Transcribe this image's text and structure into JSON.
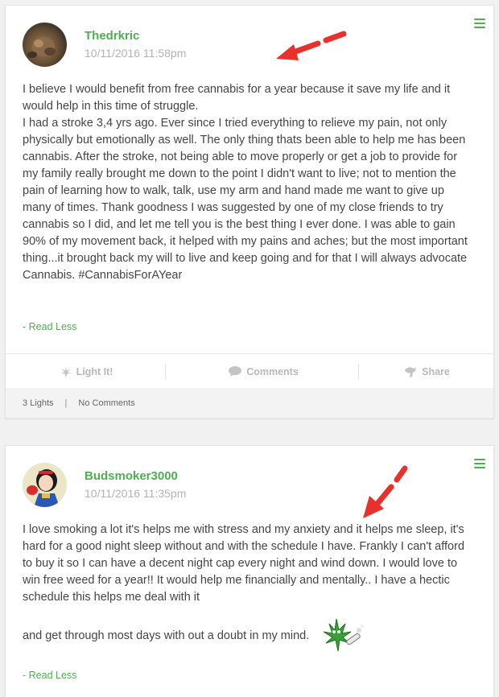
{
  "posts": [
    {
      "username": "Thedrkric",
      "timestamp": "10/11/2016 11:58pm",
      "paragraphs": [
        "I believe I would benefit from free cannabis for a year because it save my life and it would help in this time of struggle.",
        "I had a stroke 3,4 yrs ago. Ever since I tried everything to relieve my pain, not only physically but emotionally as well. The only thing thats been able to help me has been cannabis. After the stroke, not being able to move properly or get a job to provide for my family really brought me down to the point I didn't want to live; not to mention the pain of learning how to walk, talk, use my arm and hand made me want to give up many of times. Thank goodness I was suggested by one of my close friends to try cannabis so I did, and let me tell you is the best thing I ever done. I was able to gain 90% of my movement back, it helped with my pains and aches; but the most important thing...it brought back my will to live and keep going and for that I will always advocate Cannabis.  #CannabisForAYear"
      ],
      "read_less": "- Read Less",
      "actions": {
        "light": "Light It!",
        "comments": "Comments",
        "share": "Share"
      },
      "footer": {
        "lights": "3 Lights",
        "separator": "|",
        "comments": "No Comments"
      }
    },
    {
      "username": "Budsmoker3000",
      "timestamp": "10/11/2016 11:35pm",
      "paragraphs": [
        "I love smoking a lot it's helps me with stress and my anxiety and it helps me sleep, it's hard for a good night sleep without and with the schedule I have. Frankly I can't afford to buy it so I can have a decent night cap every night and wind down. I would love to win free weed for a year!! It would help me financially and mentally.. I have a hectic schedule this helps me deal with it",
        "and get through most days with out a doubt in my mind."
      ],
      "read_less": "- Read Less"
    }
  ],
  "colors": {
    "accent": "#4fae52",
    "arrow": "#e8302c",
    "muted": "#b8b8b8"
  },
  "icons": {
    "menu": "hamburger-menu-icon",
    "light": "cannabis-leaf-icon",
    "comments": "speech-bubble-icon",
    "share": "share-icon"
  }
}
